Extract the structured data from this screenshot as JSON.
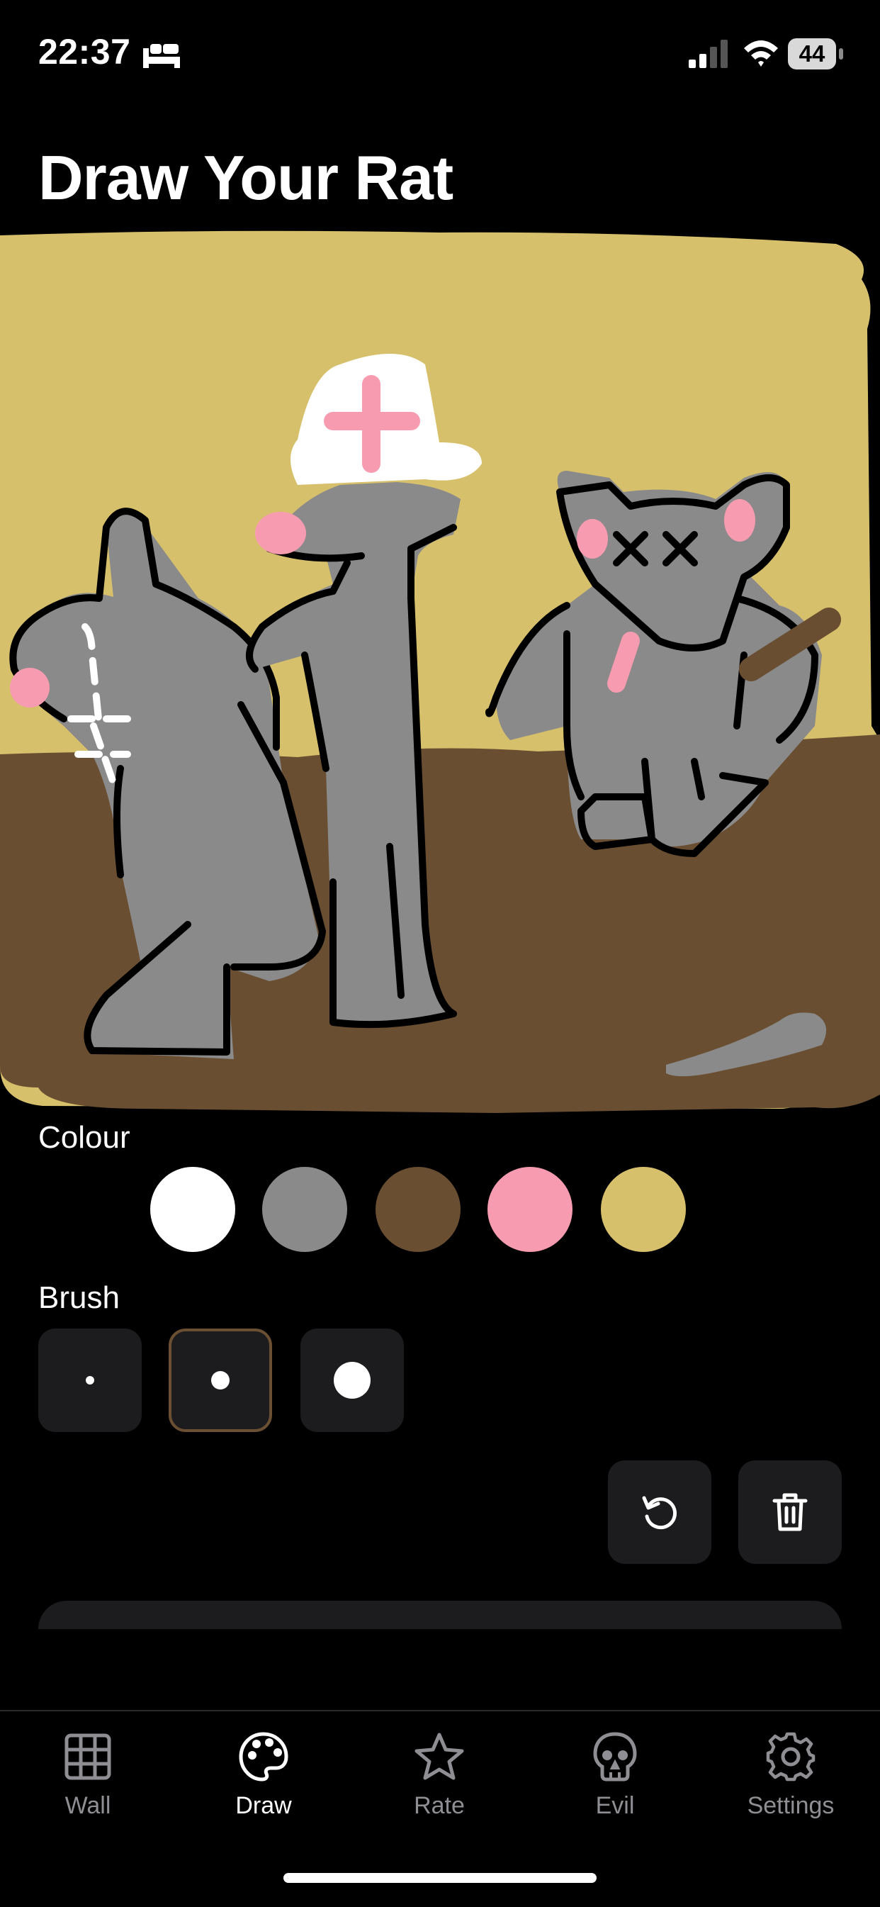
{
  "status_bar": {
    "time": "22:37",
    "battery": "44",
    "icons": [
      "bed-icon",
      "cellular-signal-icon",
      "wifi-icon",
      "battery-icon"
    ]
  },
  "page": {
    "title": "Draw Your Rat"
  },
  "canvas": {
    "description_icon": "drawing-canvas",
    "colors": {
      "sky": "#d7c06b",
      "ground": "#6a4e31",
      "rat": "#8a8a8a",
      "outline": "#000000",
      "pink": "#f79bb0",
      "white": "#ffffff"
    }
  },
  "colour_picker": {
    "label": "Colour",
    "swatches": [
      {
        "name": "white",
        "color": "#ffffff"
      },
      {
        "name": "grey",
        "color": "#8a8a8a"
      },
      {
        "name": "brown",
        "color": "#6a4e31"
      },
      {
        "name": "pink",
        "color": "#f79bb0"
      },
      {
        "name": "yellow",
        "color": "#d7c06b"
      }
    ]
  },
  "brush_picker": {
    "label": "Brush",
    "sizes": [
      "small",
      "medium",
      "large"
    ],
    "selected": "medium"
  },
  "tools": {
    "undo_icon": "undo-icon",
    "clear_icon": "trash-icon"
  },
  "tab_bar": {
    "accent": "#ffffff",
    "inactive": "#8e8e93",
    "tabs": [
      {
        "label": "Wall",
        "icon": "grid-icon"
      },
      {
        "label": "Draw",
        "icon": "palette-icon",
        "active": true
      },
      {
        "label": "Rate",
        "icon": "star-icon"
      },
      {
        "label": "Evil",
        "icon": "skull-icon"
      },
      {
        "label": "Settings",
        "icon": "gear-icon"
      }
    ]
  }
}
